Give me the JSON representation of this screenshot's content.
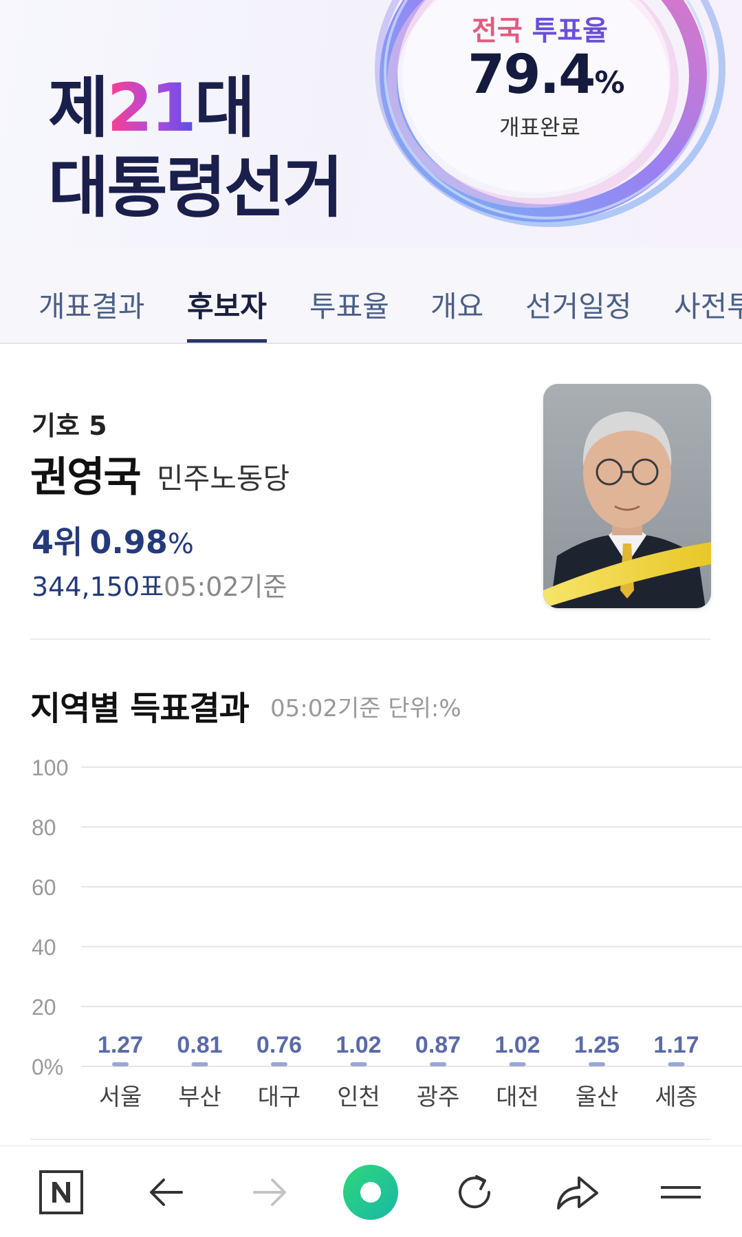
{
  "hero": {
    "title_prefix": "제",
    "title_number": "21",
    "title_suffix": "대",
    "title_line2": "대통령선거",
    "turnout_label_a": "전국",
    "turnout_label_b": "투표율",
    "turnout_value": "79.4",
    "turnout_unit": "%",
    "turnout_status": "개표완료"
  },
  "tabs": [
    {
      "label": "개표결과",
      "active": false
    },
    {
      "label": "후보자",
      "active": true
    },
    {
      "label": "투표율",
      "active": false
    },
    {
      "label": "개요",
      "active": false
    },
    {
      "label": "선거일정",
      "active": false
    },
    {
      "label": "사전투",
      "active": false
    }
  ],
  "candidate": {
    "number_label": "기호 5",
    "name": "권영국",
    "party": "민주노동당",
    "rank": "4위",
    "percent": "0.98",
    "percent_unit": "%",
    "votes": "344,150표",
    "as_of": "05:02기준",
    "photo_icon": "candidate-portrait"
  },
  "chart_section": {
    "title": "지역별 득표결과",
    "subtitle": "05:02기준 단위:%"
  },
  "chart_data": {
    "type": "bar",
    "categories": [
      "서울",
      "부산",
      "대구",
      "인천",
      "광주",
      "대전",
      "울산",
      "세종"
    ],
    "values": [
      1.27,
      0.81,
      0.76,
      1.02,
      0.87,
      1.02,
      1.25,
      1.17
    ],
    "value_labels": [
      "1.27",
      "0.81",
      "0.76",
      "1.02",
      "0.87",
      "1.02",
      "1.25",
      "1.17"
    ],
    "y_ticks": [
      "0%",
      "20",
      "40",
      "60",
      "80",
      "100"
    ],
    "ylim": [
      0,
      100
    ],
    "grid": true,
    "bar_color": "#9aa6d4",
    "label_color": "#5a6aa8"
  },
  "bottom_nav": [
    {
      "icon": "naver-n-icon"
    },
    {
      "icon": "back-arrow-icon"
    },
    {
      "icon": "forward-arrow-icon"
    },
    {
      "icon": "green-circle-icon"
    },
    {
      "icon": "reload-icon"
    },
    {
      "icon": "share-icon"
    },
    {
      "icon": "menu-icon"
    }
  ]
}
